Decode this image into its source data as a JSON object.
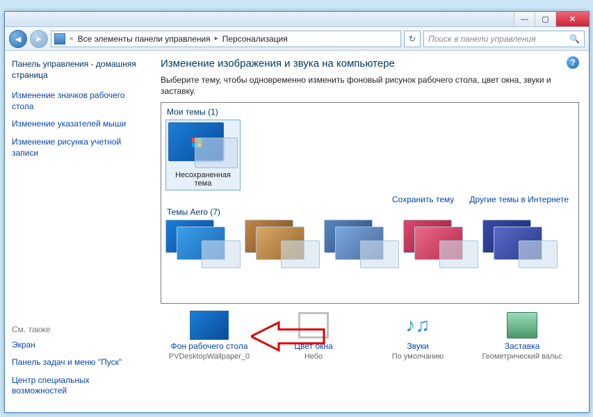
{
  "titlebar": {
    "min": "—",
    "max": "▢",
    "close": "✕"
  },
  "nav": {
    "back": "◄",
    "fwd": "▸",
    "crumb_all": "Все элементы панели управления",
    "crumb_current": "Персонализация",
    "search_placeholder": "Поиск в панели управления"
  },
  "sidebar": {
    "home": "Панель управления - домашняя страница",
    "links": [
      "Изменение значков рабочего стола",
      "Изменение указателей мыши",
      "Изменение рисунка учетной записи"
    ],
    "see_also_h": "См. также",
    "see_also": [
      "Экран",
      "Панель задач и меню \"Пуск\"",
      "Центр специальных возможностей"
    ]
  },
  "main": {
    "heading": "Изменение изображения и звука на компьютере",
    "desc": "Выберите тему, чтобы одновременно изменить фоновый рисунок рабочего стола, цвет окна, звуки и заставку.",
    "my_themes_label": "Мои темы (1)",
    "unsaved_theme": "Несохраненная тема",
    "save_theme": "Сохранить тему",
    "more_themes": "Другие темы в Интернете",
    "aero_label": "Темы Aero (7)"
  },
  "bottom": {
    "wallpaper_label": "Фон рабочего стола",
    "wallpaper_sub": "PVDesktopWallpaper_0",
    "color_label": "Цвет окна",
    "color_sub": "Небо",
    "sounds_label": "Звуки",
    "sounds_sub": "По умолчанию",
    "saver_label": "Заставка",
    "saver_sub": "Геометрический вальс"
  },
  "help": "?"
}
